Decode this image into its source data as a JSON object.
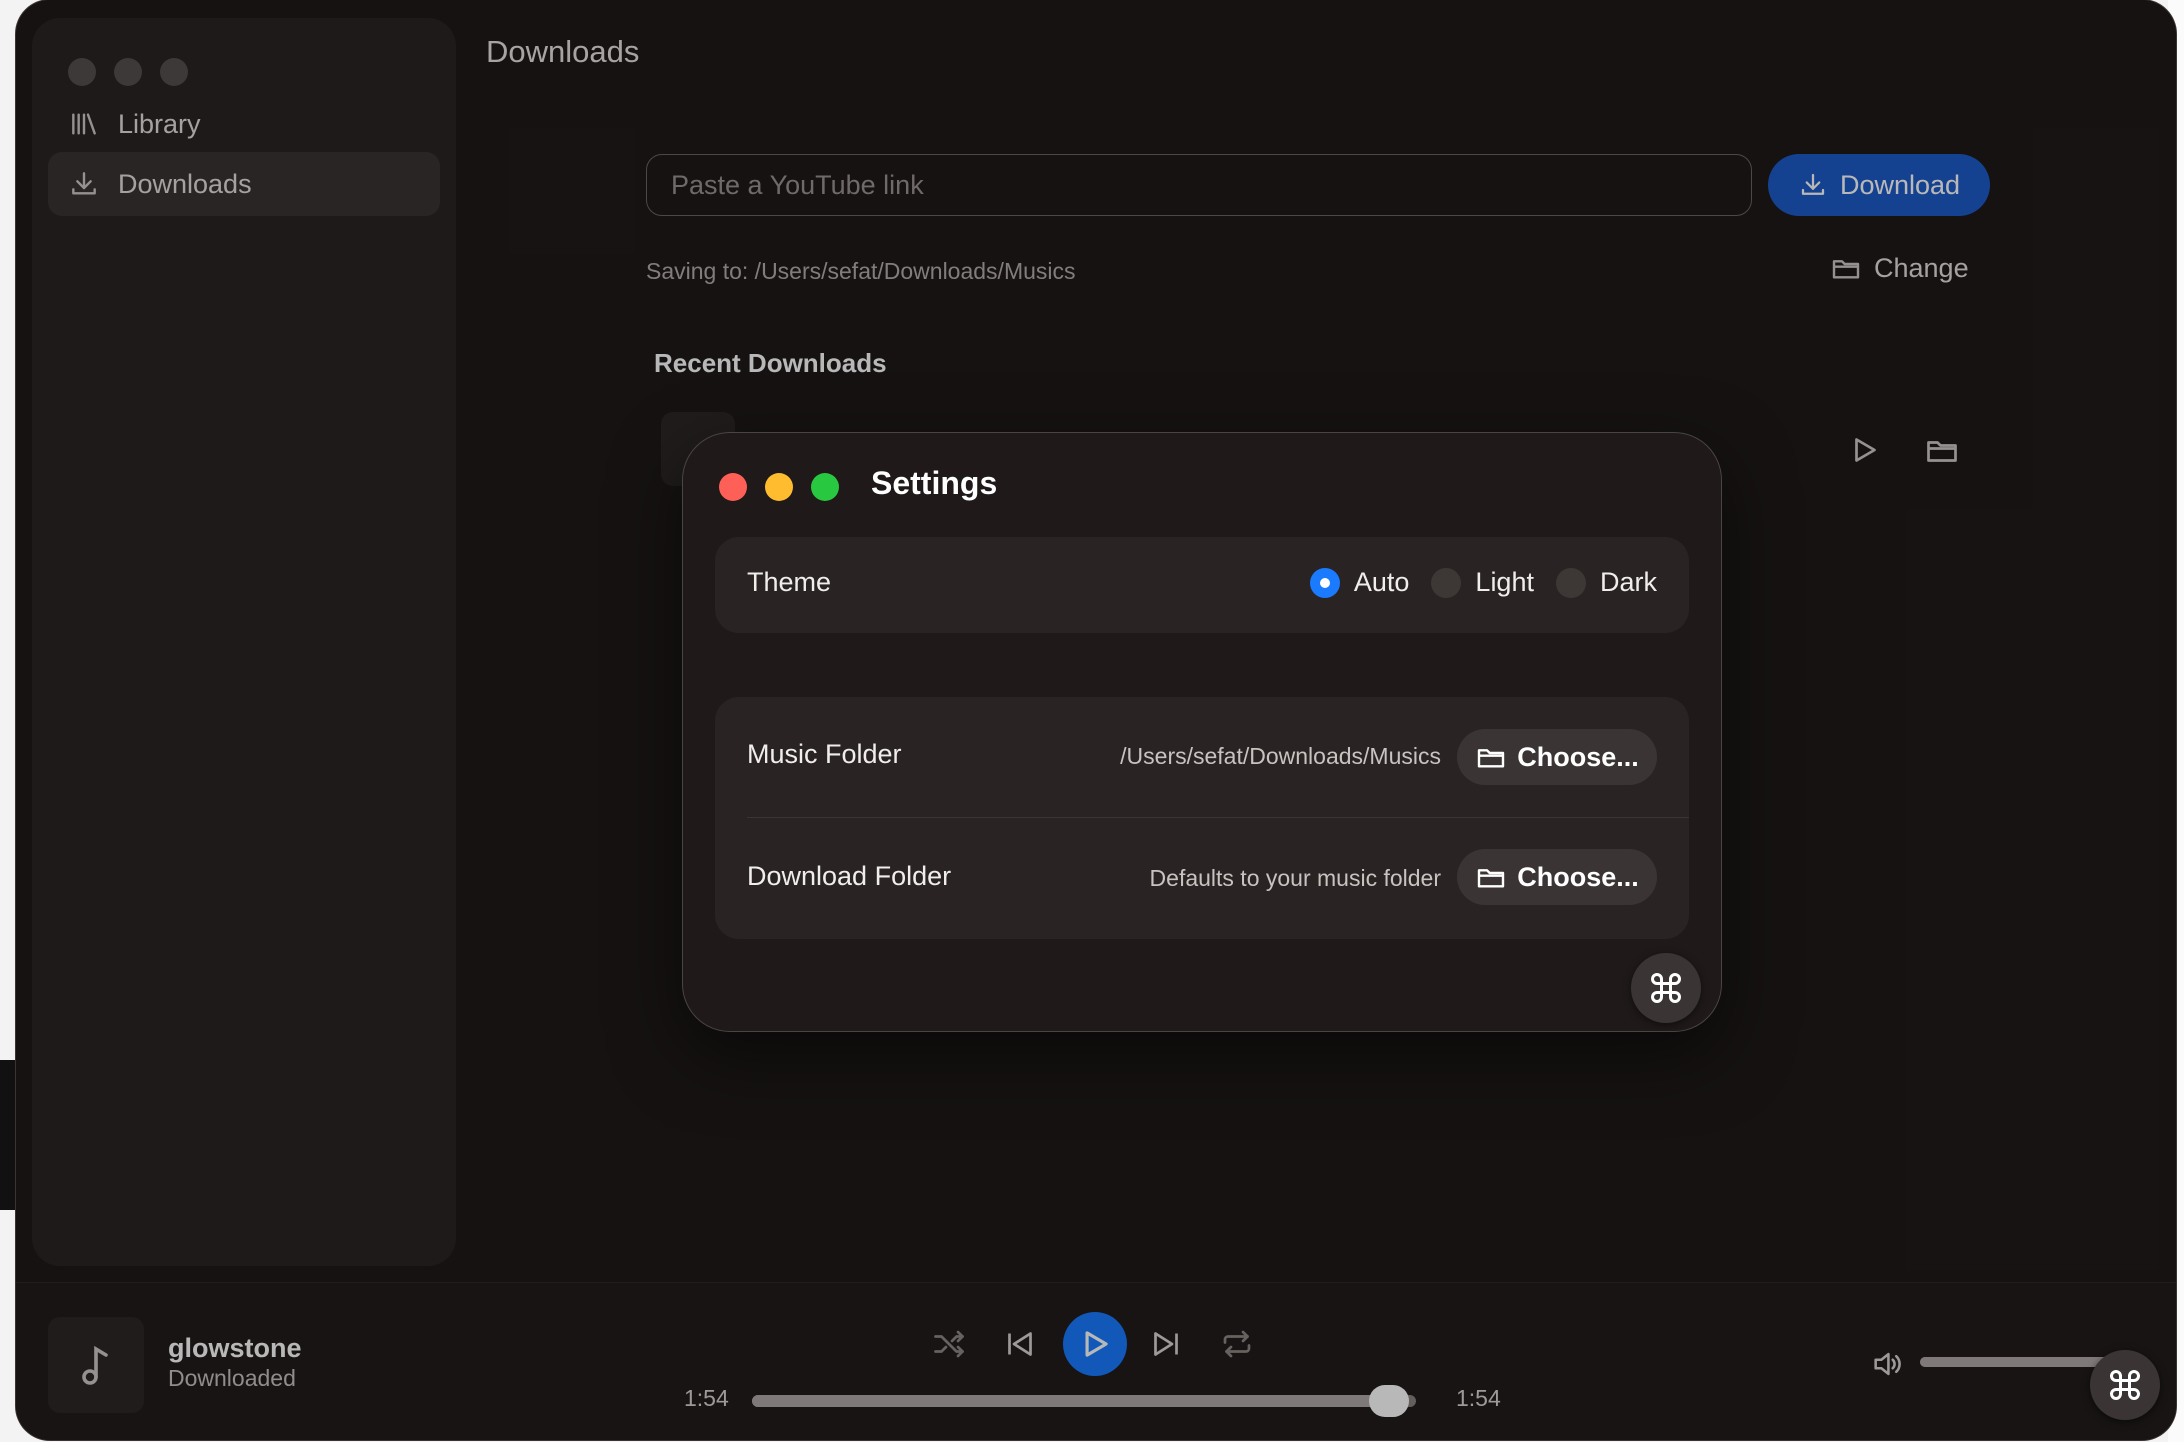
{
  "sidebar": {
    "items": [
      {
        "label": "Library",
        "icon": "library-icon"
      },
      {
        "label": "Downloads",
        "icon": "download-icon",
        "active": true
      }
    ]
  },
  "main": {
    "title": "Downloads",
    "url_placeholder": "Paste a YouTube link",
    "download_label": "Download",
    "saving_to": "Saving to: /Users/sefat/Downloads/Musics",
    "change_label": "Change",
    "recent_title": "Recent Downloads"
  },
  "settings": {
    "title": "Settings",
    "theme": {
      "label": "Theme",
      "options": [
        "Auto",
        "Light",
        "Dark"
      ],
      "selected": "Auto"
    },
    "music_folder": {
      "label": "Music Folder",
      "path": "/Users/sefat/Downloads/Musics",
      "button": "Choose..."
    },
    "download_folder": {
      "label": "Download Folder",
      "path": "Defaults to your music folder",
      "button": "Choose..."
    }
  },
  "player": {
    "title": "glowstone",
    "subtitle": "Downloaded",
    "elapsed": "1:54",
    "duration": "1:54",
    "progress": 0.96,
    "volume": 0.95
  },
  "colors": {
    "accent": "#1a7bff",
    "download_button": "#1e5cc8",
    "window_bg": "#1f1a19",
    "close": "#fe5f57",
    "minimize": "#febc2e",
    "zoom": "#28c840"
  }
}
